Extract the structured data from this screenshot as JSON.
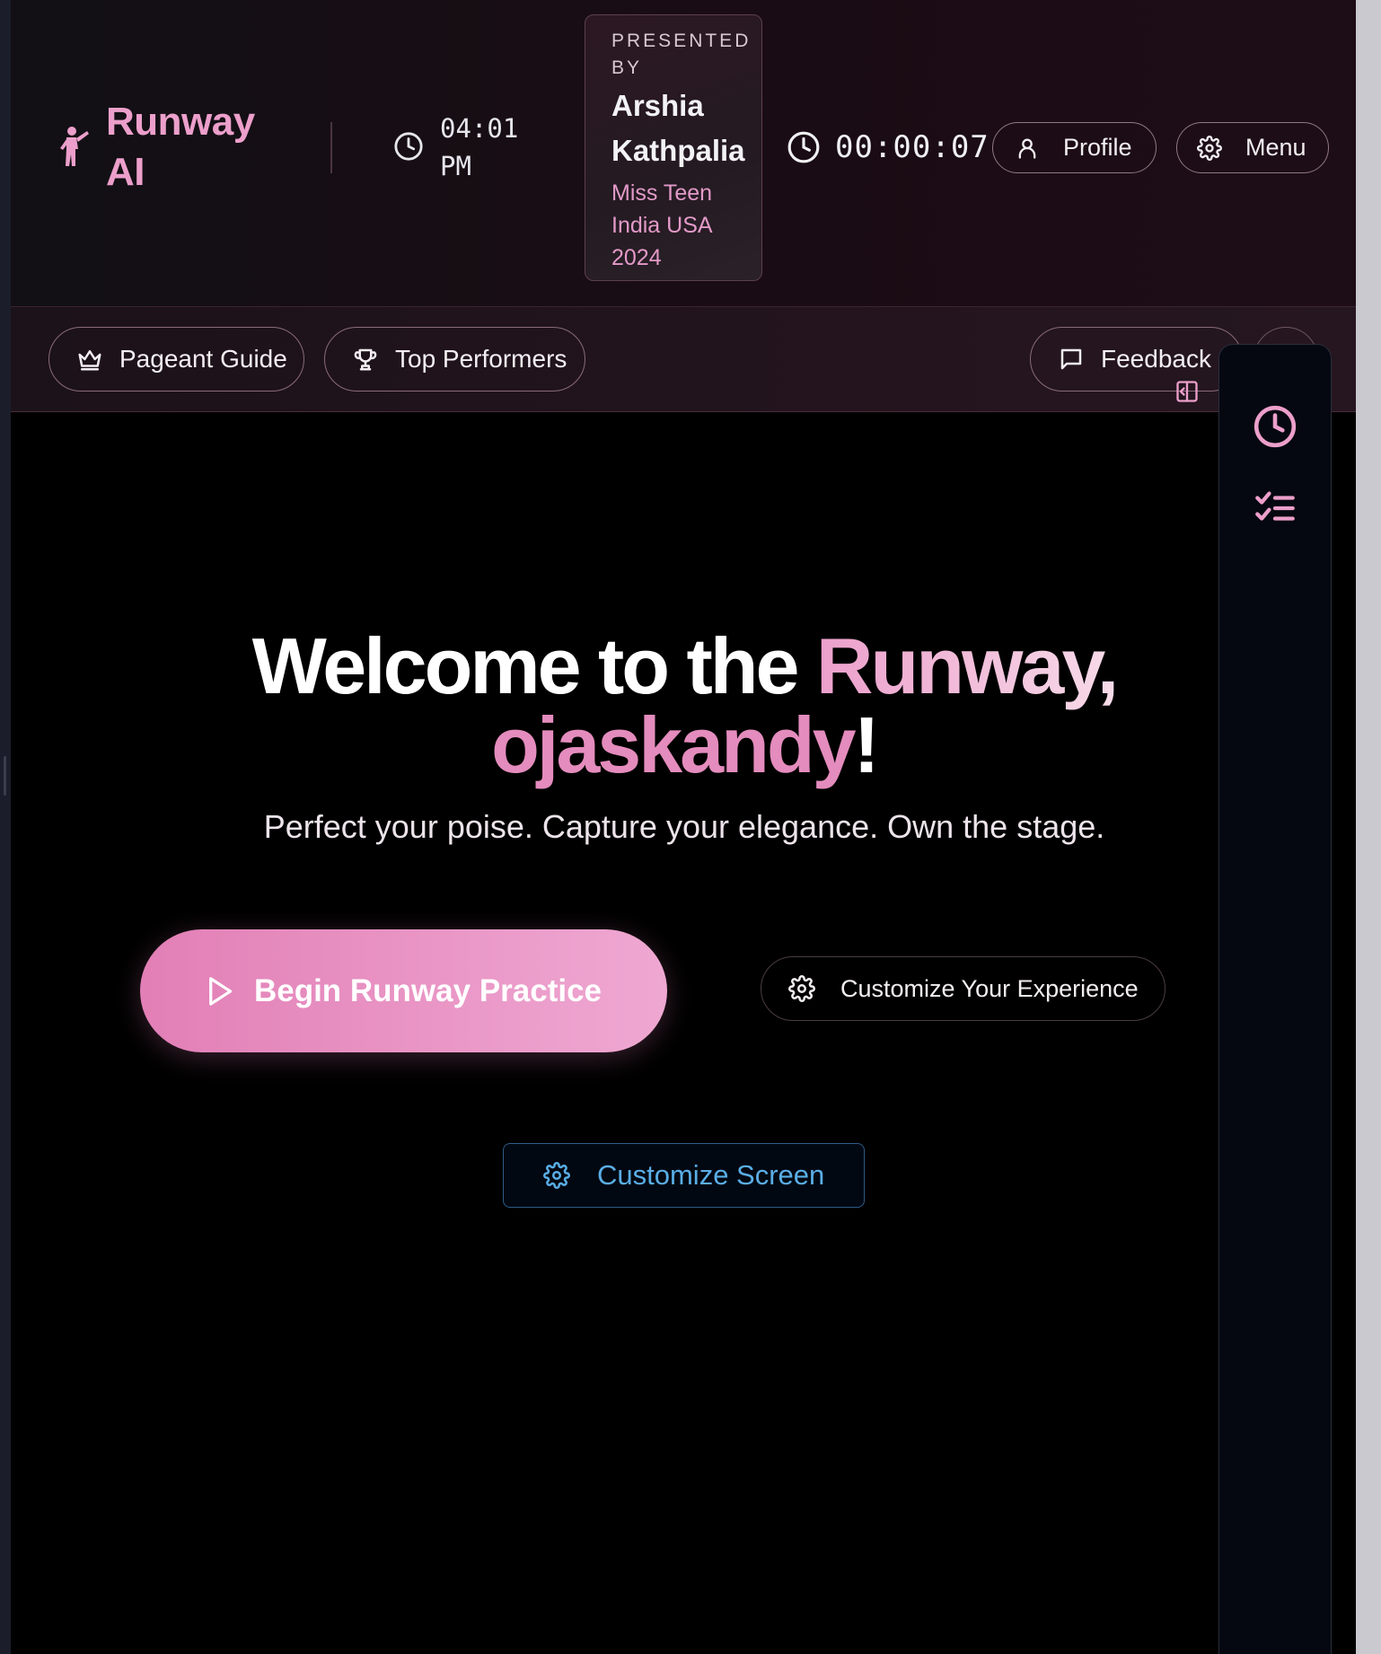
{
  "header": {
    "brand": "Runway AI",
    "clock": "04:01 PM",
    "presenter": {
      "label": "PRESENTED BY",
      "name": "Arshia Kathpalia",
      "title": "Miss Teen India USA 2024"
    },
    "timer": "00:00:07",
    "profile_label": "Profile",
    "menu_label": "Menu"
  },
  "nav": {
    "guide_label": "Pageant Guide",
    "top_label": "Top Performers",
    "feedback_label": "Feedback"
  },
  "hero": {
    "line1_start": "Welcome to the ",
    "line1_accent": "Runway,",
    "username": "ojaskandy",
    "exclaim": "!",
    "tagline": "Perfect your poise. Capture your elegance. Own the stage.",
    "begin_label": "Begin Runway Practice",
    "customize_experience_label": "Customize Your Experience",
    "customize_screen_label": "Customize Screen"
  },
  "tools": [
    "clock-icon",
    "checklist-icon"
  ],
  "colors": {
    "accent_pink": "#ec9fcb",
    "username_pink": "#e48cbd",
    "link_blue": "#5aaee6",
    "background": "#000000"
  }
}
